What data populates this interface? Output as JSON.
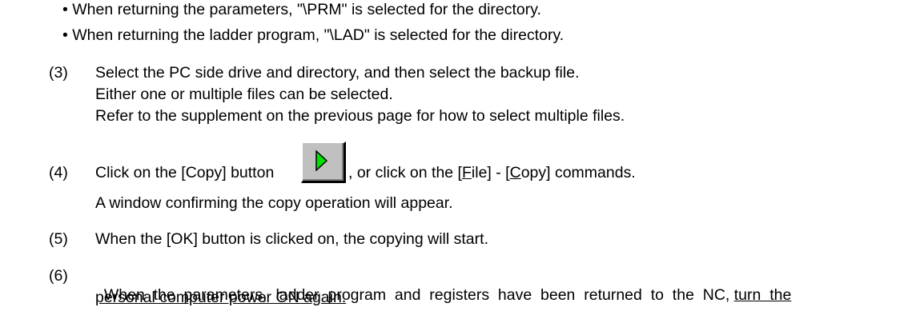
{
  "bullets": [
    "• When returning the parameters, \"\\PRM\" is selected for the directory.",
    "• When returning the ladder program, \"\\LAD\" is selected for the directory."
  ],
  "step3": {
    "num": "(3)",
    "lines": [
      "Select the PC side drive and directory, and then select the backup file.",
      "Either one or multiple files can be selected.",
      "Refer to the supplement on the previous page for how to select multiple files."
    ]
  },
  "step4": {
    "num": "(4)",
    "before_button": "Click on the [Copy] button",
    "after_button_1": ", or click on the [",
    "menu_file_key": "F",
    "menu_file_rest": "ile] - [",
    "menu_copy_key": "C",
    "menu_copy_rest": "opy] commands.",
    "line2": "A window confirming the copy operation will appear.",
    "button_icon": "play-arrow-icon",
    "button_arrow_color": "#00e000",
    "button_face_color": "#c0c0c0"
  },
  "step5": {
    "num": "(5)",
    "text": "When the [OK] button is clicked on, the copying will start."
  },
  "step6": {
    "num": "(6)",
    "line1_plain": "When  the  parameters,  ladder  program  and  registers  have  been  returned  to  the  NC,",
    "line1_underlined": "turn  the",
    "line2_underlined": "personal computer power ON again."
  }
}
